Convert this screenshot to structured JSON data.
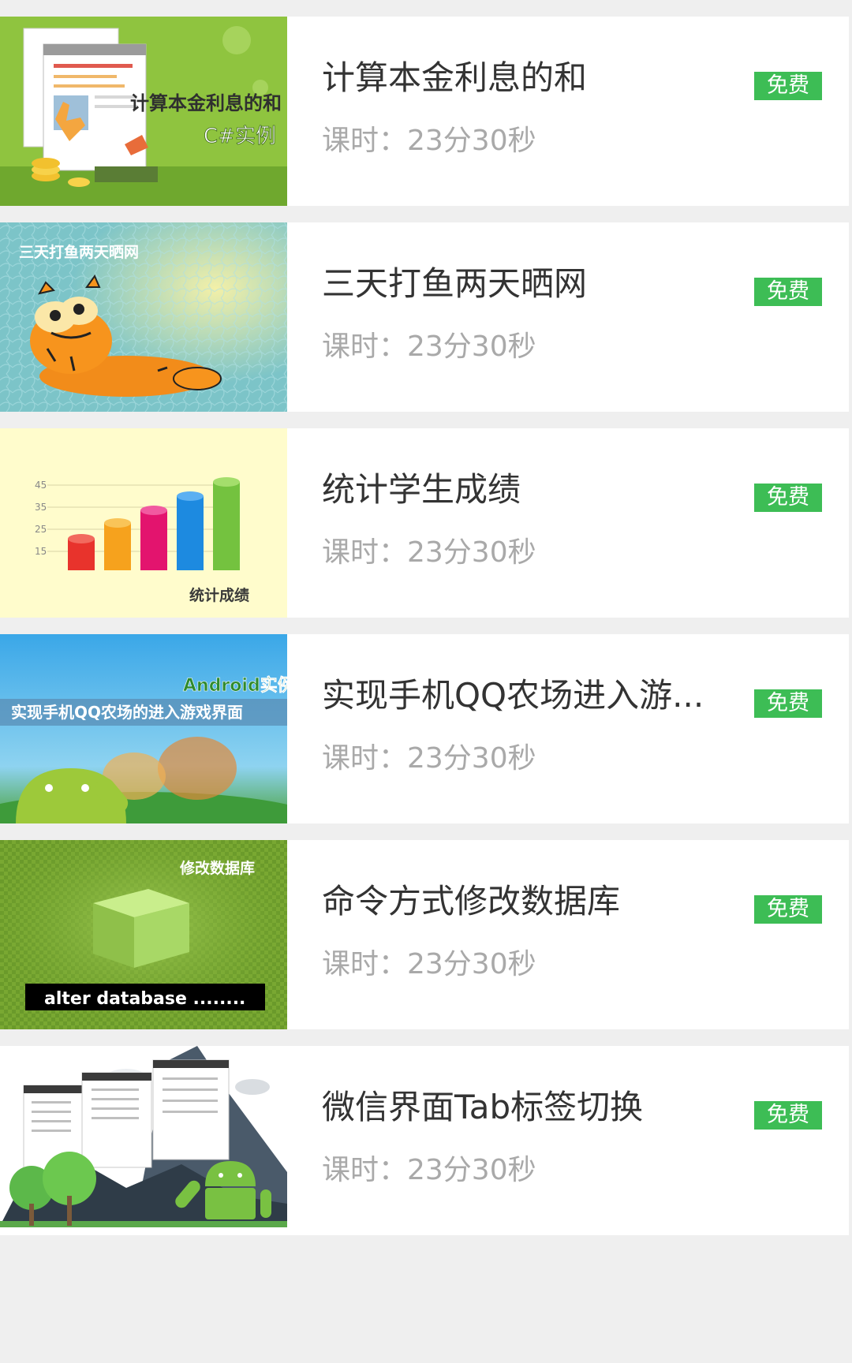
{
  "courses": [
    {
      "title": "计算本金利息的和",
      "duration_label": "课时：23分30秒",
      "badge": "免费",
      "thumb_caption": "计算本金利息的和",
      "thumb_subcaption": "C#实例"
    },
    {
      "title": "三天打鱼两天晒网",
      "duration_label": "课时：23分30秒",
      "badge": "免费",
      "thumb_caption": "三天打鱼两天晒网"
    },
    {
      "title": "统计学生成绩",
      "duration_label": "课时：23分30秒",
      "badge": "免费",
      "thumb_caption": "统计成绩",
      "thumb_axis": [
        "45",
        "35",
        "25",
        "15"
      ]
    },
    {
      "title": "实现手机QQ农场进入游...",
      "duration_label": "课时：23分30秒",
      "badge": "免费",
      "thumb_caption": "实现手机QQ农场的进入游戏界面",
      "thumb_subcaption": "Android实例"
    },
    {
      "title": "命令方式修改数据库",
      "duration_label": "课时：23分30秒",
      "badge": "免费",
      "thumb_caption": "修改数据库",
      "thumb_subcaption": "alter database ........"
    },
    {
      "title": "微信界面Tab标签切换",
      "duration_label": "课时：23分30秒",
      "badge": "免费"
    }
  ],
  "colors": {
    "badge_bg": "#3dbd55",
    "title": "#333333",
    "duration": "#a9a9a9",
    "page_bg": "#efefef"
  }
}
